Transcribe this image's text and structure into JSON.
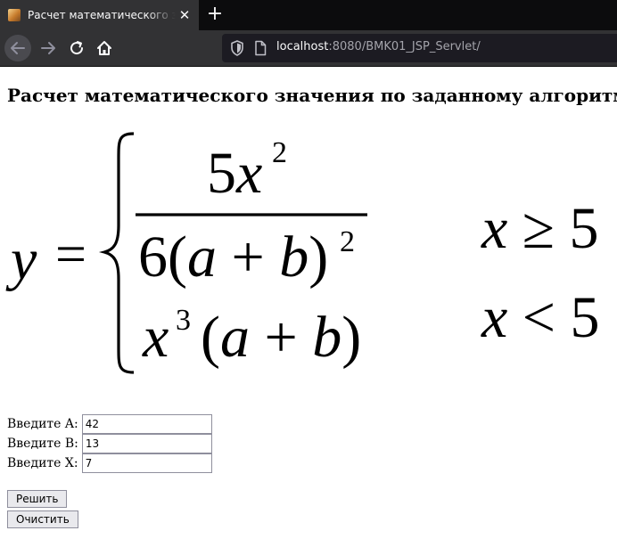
{
  "browser": {
    "tab": {
      "title": "Расчет математического значе",
      "close_icon": "close-icon"
    },
    "new_tab_icon": "plus-icon",
    "nav": {
      "back_icon": "arrow-left-icon",
      "forward_icon": "arrow-right-icon",
      "reload_icon": "reload-icon",
      "home_icon": "home-icon"
    },
    "url": {
      "host": "localhost",
      "rest": ":8080/BMK01_JSP_Servlet/"
    }
  },
  "page": {
    "title": "Расчет математического значения по заданному алгоритму",
    "formula": {
      "lhs": "y",
      "eq": "=",
      "case1": {
        "numerator": "5x",
        "numerator_exp": "2",
        "denominator": "6(a + b)",
        "denominator_exp": "2",
        "condition": "x ≥ 5"
      },
      "case2": {
        "expr_base": "x",
        "expr_exp": "3",
        "expr_rest": "(a + b)",
        "condition": "x < 5"
      }
    },
    "form": {
      "a": {
        "label": "Введите A:",
        "value": "42"
      },
      "b": {
        "label": "Введите B:",
        "value": "13"
      },
      "x": {
        "label": "Введите X:",
        "value": "7"
      },
      "submit_label": "Решить",
      "reset_label": "Очистить"
    }
  }
}
